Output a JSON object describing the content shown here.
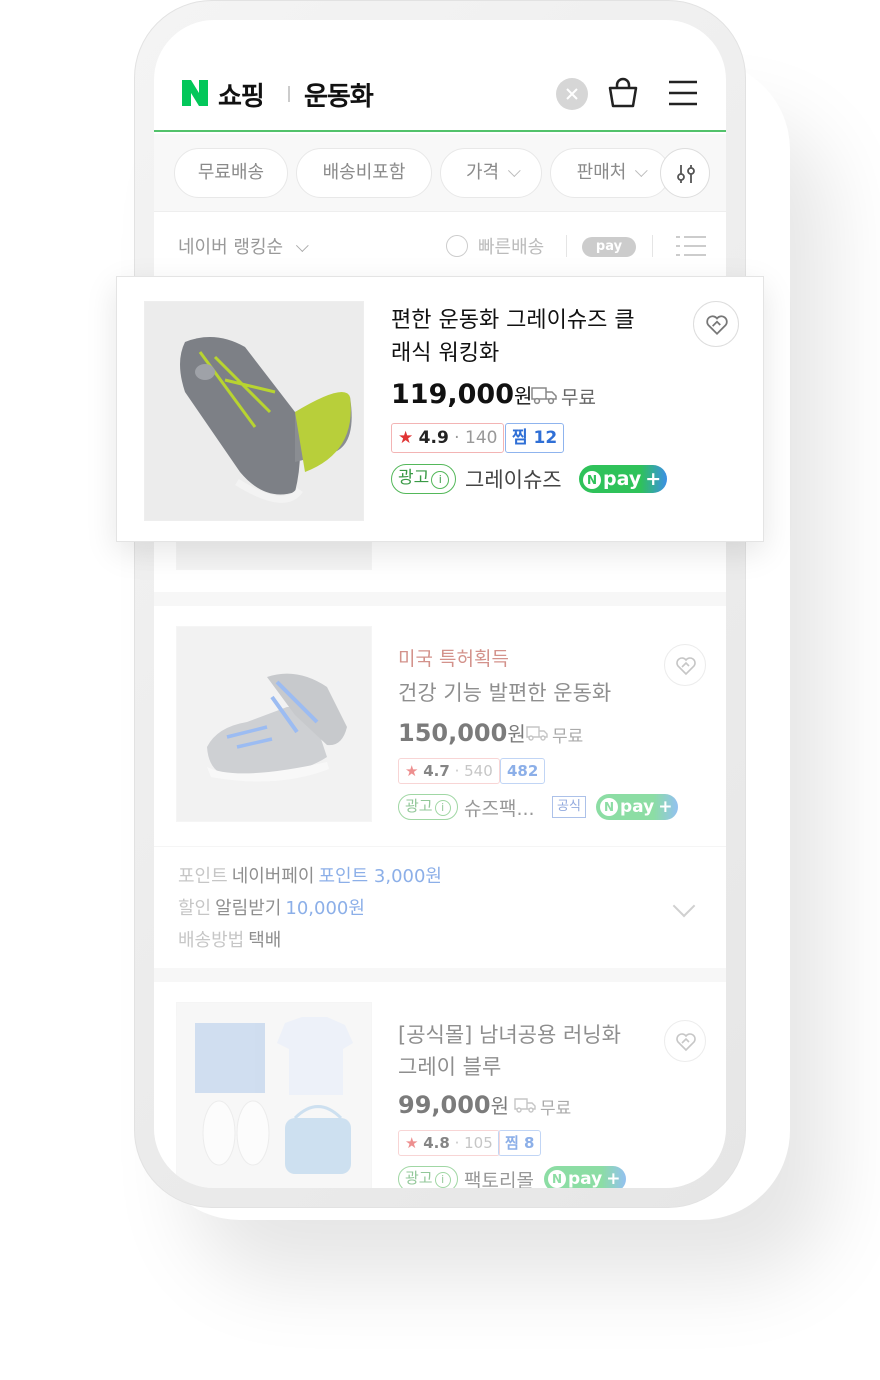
{
  "header": {
    "brand": "쇼핑",
    "query": "운동화"
  },
  "filters": [
    {
      "label": "무료배송",
      "chevron": false
    },
    {
      "label": "배송비포함",
      "chevron": false
    },
    {
      "label": "가격",
      "chevron": true
    },
    {
      "label": "판매처",
      "chevron": true
    }
  ],
  "sortbar": {
    "sort_label": "네이버 랭킹순",
    "fast_ship": "빠른배송",
    "npay": "pay"
  },
  "highlight": {
    "title_line1": "편한 운동화 그레이슈즈 클",
    "title_line2": "래식 워킹화",
    "price": "119,000",
    "won": "원",
    "ship": "무료",
    "rating": "4.9",
    "reviews": "140",
    "jjim": "찜 12",
    "ad": "광고",
    "seller": "그레이슈즈",
    "npay": "pay"
  },
  "item2": {
    "tagline": "미국 특허획득",
    "title": "건강 기능 발편한 운동화",
    "price": "150,000",
    "won": "원",
    "ship": "무료",
    "rating": "4.7",
    "reviews": "540",
    "jjim": "482",
    "ad": "광고",
    "seller": "슈즈팩...",
    "official": "공식",
    "npay": "pay"
  },
  "benefits": {
    "point_label": "포인트",
    "point_value": "네이버페이",
    "point_amount": "포인트 3,000원",
    "discount_label": "할인",
    "discount_value": "알림받기",
    "discount_amount": "10,000원",
    "ship_label": "배송방법",
    "ship_value": "택배"
  },
  "item3": {
    "title_line1": "[공식몰] 남녀공용 러닝화",
    "title_line2": "그레이 블루",
    "price": "99,000",
    "won": "원",
    "ship": "무료",
    "rating": "4.8",
    "reviews": "105",
    "jjim": "찜 8",
    "ad": "광고",
    "seller": "팩토리몰",
    "npay": "pay"
  },
  "colors": {
    "naver_green": "#03c75a",
    "npay_green": "#2fc25a",
    "npay_blue": "#3c8fe6",
    "rating_red": "#e03434",
    "link_blue": "#2f6fd6"
  }
}
